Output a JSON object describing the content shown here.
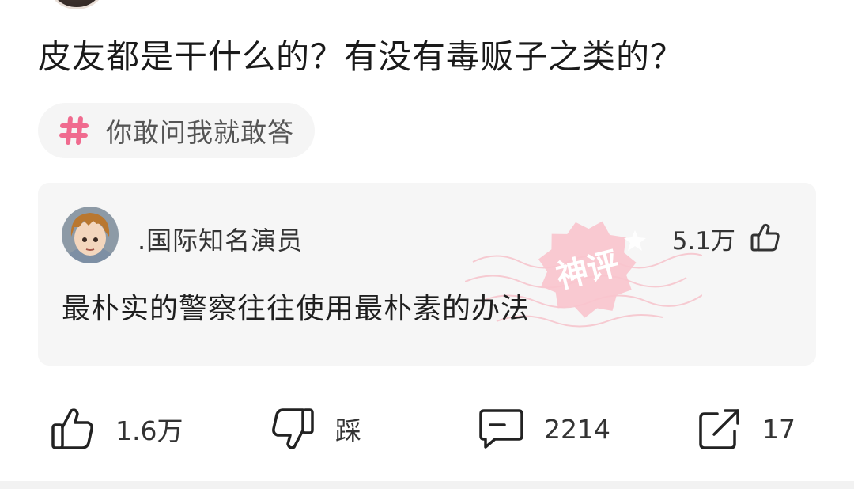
{
  "post": {
    "title": "皮友都是干什么的？有没有毒贩子之类的？",
    "topic": {
      "icon": "hashtag-icon",
      "label": "你敢问我就敢答"
    }
  },
  "god_comment": {
    "stamp_text": "神评",
    "author": ".国际知名演员",
    "likes": "5.1万",
    "text": "最朴实的警察往往使用最朴素的办法"
  },
  "actions": {
    "like": "1.6万",
    "dislike": "踩",
    "comment": "2214",
    "share": "17"
  },
  "colors": {
    "hashtag": "#f06b8f",
    "stamp": "#f7b7c2",
    "card_bg": "#f6f6f6",
    "text_primary": "#1f1f1f",
    "text_secondary": "#555555"
  }
}
